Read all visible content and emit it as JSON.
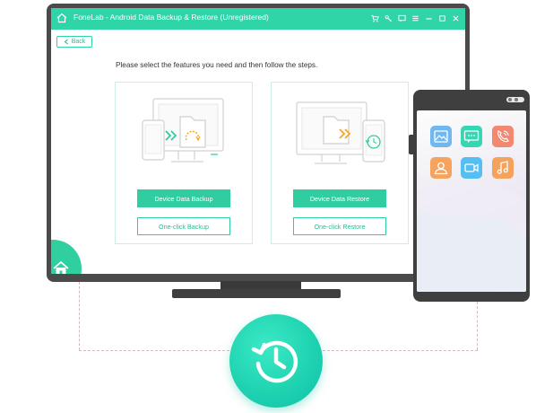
{
  "window": {
    "title": "FoneLab - Android Data Backup & Restore (Unregistered)",
    "toolbar_icons": [
      "cart-icon",
      "key-icon",
      "feedback-icon",
      "menu-icon",
      "minimize-icon",
      "close-icon"
    ],
    "accent_color": "#2fd4a7"
  },
  "nav": {
    "back_label": "Back"
  },
  "main": {
    "instruction": "Please select the features you need and then follow the steps.",
    "backup": {
      "primary_label": "Device Data Backup",
      "secondary_label": "One-click Backup"
    },
    "restore": {
      "primary_label": "Device Data Restore",
      "secondary_label": "One-click Restore"
    }
  },
  "tablet": {
    "apps": [
      {
        "name": "photos-app-icon",
        "color": "#6fb8f2"
      },
      {
        "name": "messages-app-icon",
        "color": "#37d6b3"
      },
      {
        "name": "call-log-app-icon",
        "color": "#f3876f"
      },
      {
        "name": "contacts-app-icon",
        "color": "#f5a460"
      },
      {
        "name": "video-app-icon",
        "color": "#56bff2"
      },
      {
        "name": "music-app-icon",
        "color": "#f4a25c"
      }
    ]
  }
}
